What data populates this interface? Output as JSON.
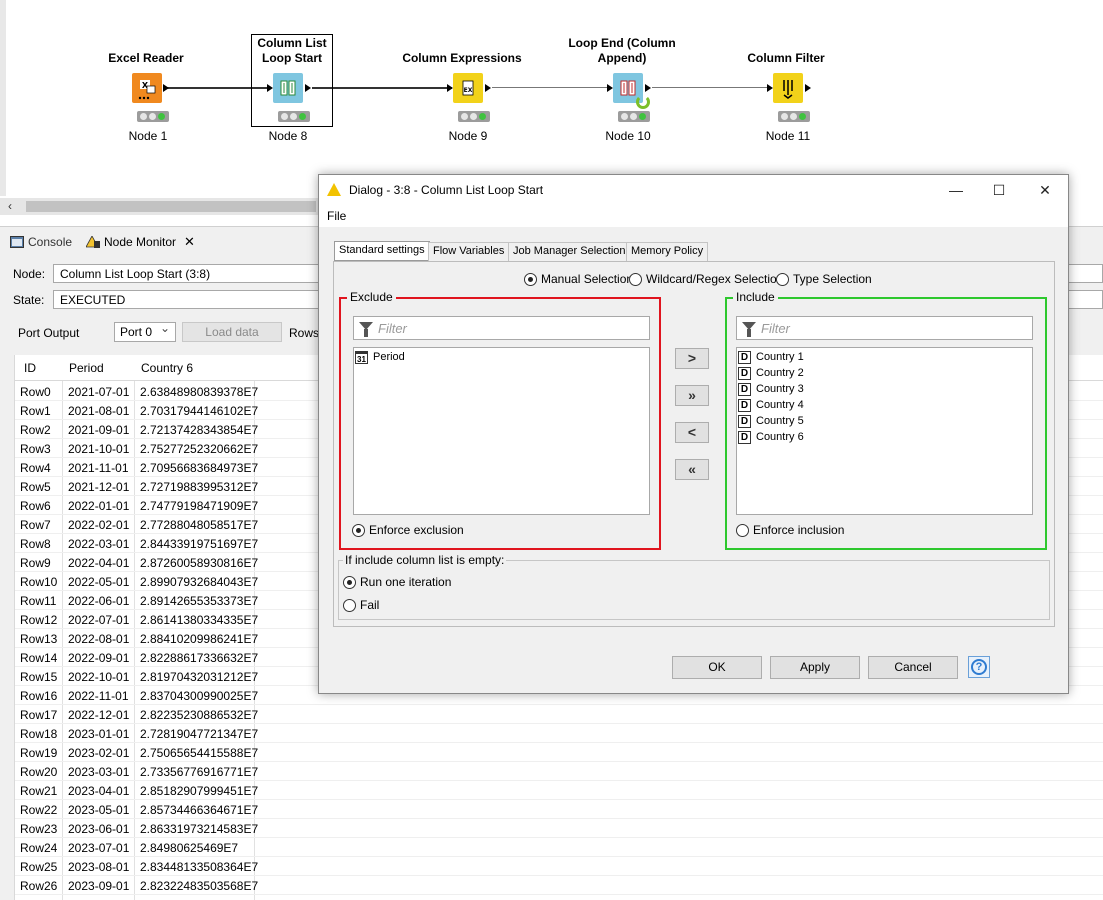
{
  "workflow": {
    "nodes": [
      {
        "title": "Excel Reader",
        "label": "Node 1",
        "color": "#f0891f",
        "icon": "excel-reader-icon"
      },
      {
        "title": "Column List Loop Start",
        "label": "Node 8",
        "color": "#7fc6e0",
        "icon": "loop-start-icon"
      },
      {
        "title": "Column Expressions",
        "label": "Node 9",
        "color": "#f2d21a",
        "icon": "column-expressions-icon"
      },
      {
        "title": "Loop End (Column Append)",
        "label": "Node 10",
        "color": "#7fc6e0",
        "icon": "loop-end-icon"
      },
      {
        "title": "Column Filter",
        "label": "Node 11",
        "color": "#f2d21a",
        "icon": "column-filter-icon"
      }
    ]
  },
  "panel": {
    "tabs": [
      {
        "label": "Console",
        "icon": "console-icon"
      },
      {
        "label": "Node Monitor",
        "icon": "node-monitor-icon"
      }
    ],
    "node_label": "Node:",
    "node_value": "Column List Loop Start  (3:8)",
    "state_label": "State:",
    "state_value": "EXECUTED",
    "port_output_label": "Port Output",
    "port_value": "Port 0",
    "load_data_label": "Load data",
    "rows_label": "Rows:",
    "table": {
      "headers": [
        "ID",
        "Period",
        "Country 6"
      ],
      "rows": [
        [
          "Row0",
          "2021-07-01",
          "2.63848980839378E7"
        ],
        [
          "Row1",
          "2021-08-01",
          "2.70317944146102E7"
        ],
        [
          "Row2",
          "2021-09-01",
          "2.72137428343854E7"
        ],
        [
          "Row3",
          "2021-10-01",
          "2.75277252320662E7"
        ],
        [
          "Row4",
          "2021-11-01",
          "2.70956683684973E7"
        ],
        [
          "Row5",
          "2021-12-01",
          "2.72719883995312E7"
        ],
        [
          "Row6",
          "2022-01-01",
          "2.74779198471909E7"
        ],
        [
          "Row7",
          "2022-02-01",
          "2.77288048058517E7"
        ],
        [
          "Row8",
          "2022-03-01",
          "2.84433919751697E7"
        ],
        [
          "Row9",
          "2022-04-01",
          "2.87260058930816E7"
        ],
        [
          "Row10",
          "2022-05-01",
          "2.89907932684043E7"
        ],
        [
          "Row11",
          "2022-06-01",
          "2.89142655353373E7"
        ],
        [
          "Row12",
          "2022-07-01",
          "2.86141380334335E7"
        ],
        [
          "Row13",
          "2022-08-01",
          "2.88410209986241E7"
        ],
        [
          "Row14",
          "2022-09-01",
          "2.82288617336632E7"
        ],
        [
          "Row15",
          "2022-10-01",
          "2.81970432031212E7"
        ],
        [
          "Row16",
          "2022-11-01",
          "2.83704300990025E7"
        ],
        [
          "Row17",
          "2022-12-01",
          "2.82235230886532E7"
        ],
        [
          "Row18",
          "2023-01-01",
          "2.72819047721347E7"
        ],
        [
          "Row19",
          "2023-02-01",
          "2.75065654415588E7"
        ],
        [
          "Row20",
          "2023-03-01",
          "2.73356776916771E7"
        ],
        [
          "Row21",
          "2023-04-01",
          "2.85182907999451E7"
        ],
        [
          "Row22",
          "2023-05-01",
          "2.85734466364671E7"
        ],
        [
          "Row23",
          "2023-06-01",
          "2.86331973214583E7"
        ],
        [
          "Row24",
          "2023-07-01",
          "2.84980625469E7"
        ],
        [
          "Row25",
          "2023-08-01",
          "2.83448133508364E7"
        ],
        [
          "Row26",
          "2023-09-01",
          "2.82322483503568E7"
        ]
      ]
    }
  },
  "dialog": {
    "title": "Dialog - 3:8 - Column List Loop Start",
    "menu_file": "File",
    "window_buttons": {
      "minimize": "—",
      "maximize": "☐",
      "close": "✕"
    },
    "tabs": [
      "Standard settings",
      "Flow Variables",
      "Job Manager Selection",
      "Memory Policy"
    ],
    "selection_modes": [
      {
        "label": "Manual Selection",
        "selected": true
      },
      {
        "label": "Wildcard/Regex Selection",
        "selected": false
      },
      {
        "label": "Type Selection",
        "selected": false
      }
    ],
    "exclude": {
      "legend": "Exclude",
      "filter_placeholder": "Filter",
      "items": [
        {
          "label": "Period",
          "type": "date"
        }
      ],
      "enforce_label": "Enforce exclusion",
      "enforce_selected": true,
      "border_color": "#e0141e"
    },
    "include": {
      "legend": "Include",
      "filter_placeholder": "Filter",
      "items": [
        {
          "label": "Country 1",
          "type": "D"
        },
        {
          "label": "Country 2",
          "type": "D"
        },
        {
          "label": "Country 3",
          "type": "D"
        },
        {
          "label": "Country 4",
          "type": "D"
        },
        {
          "label": "Country 5",
          "type": "D"
        },
        {
          "label": "Country 6",
          "type": "D"
        }
      ],
      "enforce_label": "Enforce inclusion",
      "enforce_selected": false,
      "border_color": "#2ec82e"
    },
    "move_buttons": [
      ">",
      "»",
      "<",
      "«"
    ],
    "empty_group": {
      "legend": "If include column list is empty:",
      "options": [
        {
          "label": "Run one iteration",
          "selected": true
        },
        {
          "label": "Fail",
          "selected": false
        }
      ]
    },
    "buttons": {
      "ok": "OK",
      "apply": "Apply",
      "cancel": "Cancel",
      "help": "?"
    }
  }
}
